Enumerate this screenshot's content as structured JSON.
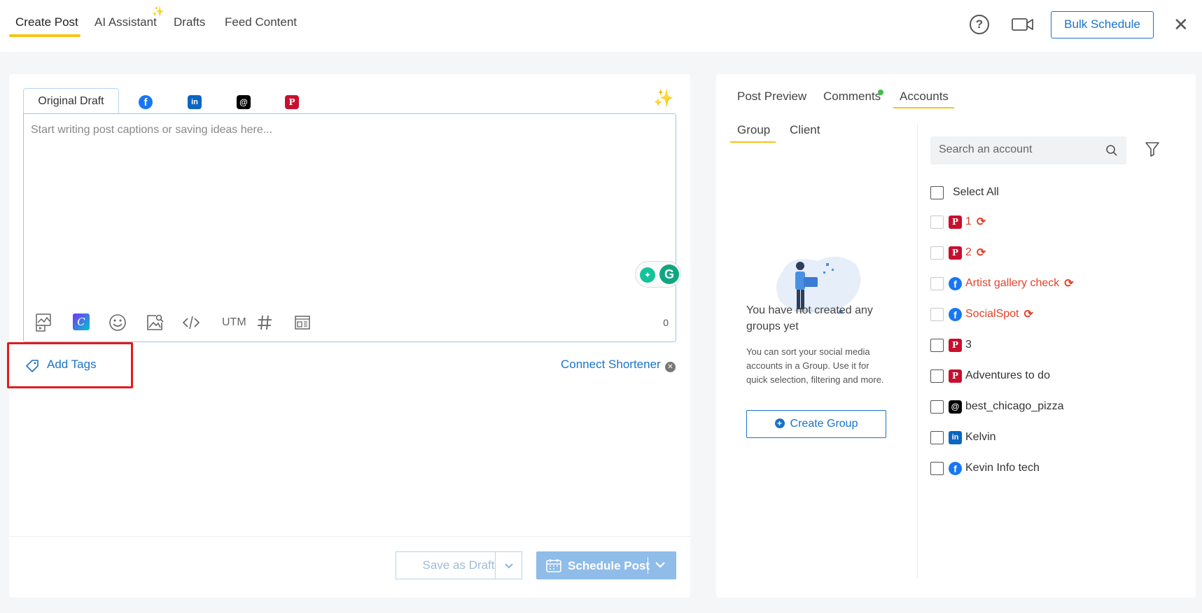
{
  "topnav": {
    "tabs": [
      {
        "label": "Create Post"
      },
      {
        "label": "AI Assistant"
      },
      {
        "label": "Drafts"
      },
      {
        "label": "Feed Content"
      }
    ],
    "help": "?",
    "bulk_schedule": "Bulk Schedule",
    "close": "✕"
  },
  "editor": {
    "draft_tab": "Original Draft",
    "placeholder": "Start writing post captions or saving ideas here...",
    "utm": "UTM",
    "char_count": "0",
    "network_tabs": [
      "facebook-icon",
      "linkedin-icon",
      "threads-icon",
      "pinterest-icon"
    ]
  },
  "tags": {
    "add_tags": "Add Tags",
    "connect_shortener": "Connect Shortener"
  },
  "footer": {
    "save_draft": "Save as Draft",
    "schedule_post": "Schedule Post"
  },
  "right": {
    "tabs": [
      {
        "label": "Post Preview"
      },
      {
        "label": "Comments"
      },
      {
        "label": "Accounts"
      }
    ],
    "subtabs": [
      {
        "label": "Group"
      },
      {
        "label": "Client"
      }
    ],
    "empty_title": "You have not created any groups yet",
    "empty_desc": "You can sort your social media accounts in a Group. Use it for quick selection, filtering and more.",
    "create_group": "Create Group",
    "search_placeholder": "Search an account",
    "select_all": "Select All",
    "accounts": [
      {
        "name": "1",
        "network": "pinterest",
        "error": true
      },
      {
        "name": "2",
        "network": "pinterest",
        "error": true
      },
      {
        "name": "Artist gallery check",
        "network": "facebook",
        "error": true
      },
      {
        "name": "SocialSpot",
        "network": "facebook",
        "error": true
      },
      {
        "name": "3",
        "network": "pinterest",
        "error": false
      },
      {
        "name": "Adventures to do",
        "network": "pinterest",
        "error": false
      },
      {
        "name": "best_chicago_pizza",
        "network": "threads",
        "error": false
      },
      {
        "name": "Kelvin",
        "network": "linkedin",
        "error": false
      },
      {
        "name": "Kevin Info tech",
        "network": "facebook",
        "error": false
      }
    ]
  },
  "colors": {
    "accent": "#1a73c9",
    "tab_underline": "#f5c518",
    "error": "#e0442a",
    "highlight_box": "#e21b1b"
  }
}
